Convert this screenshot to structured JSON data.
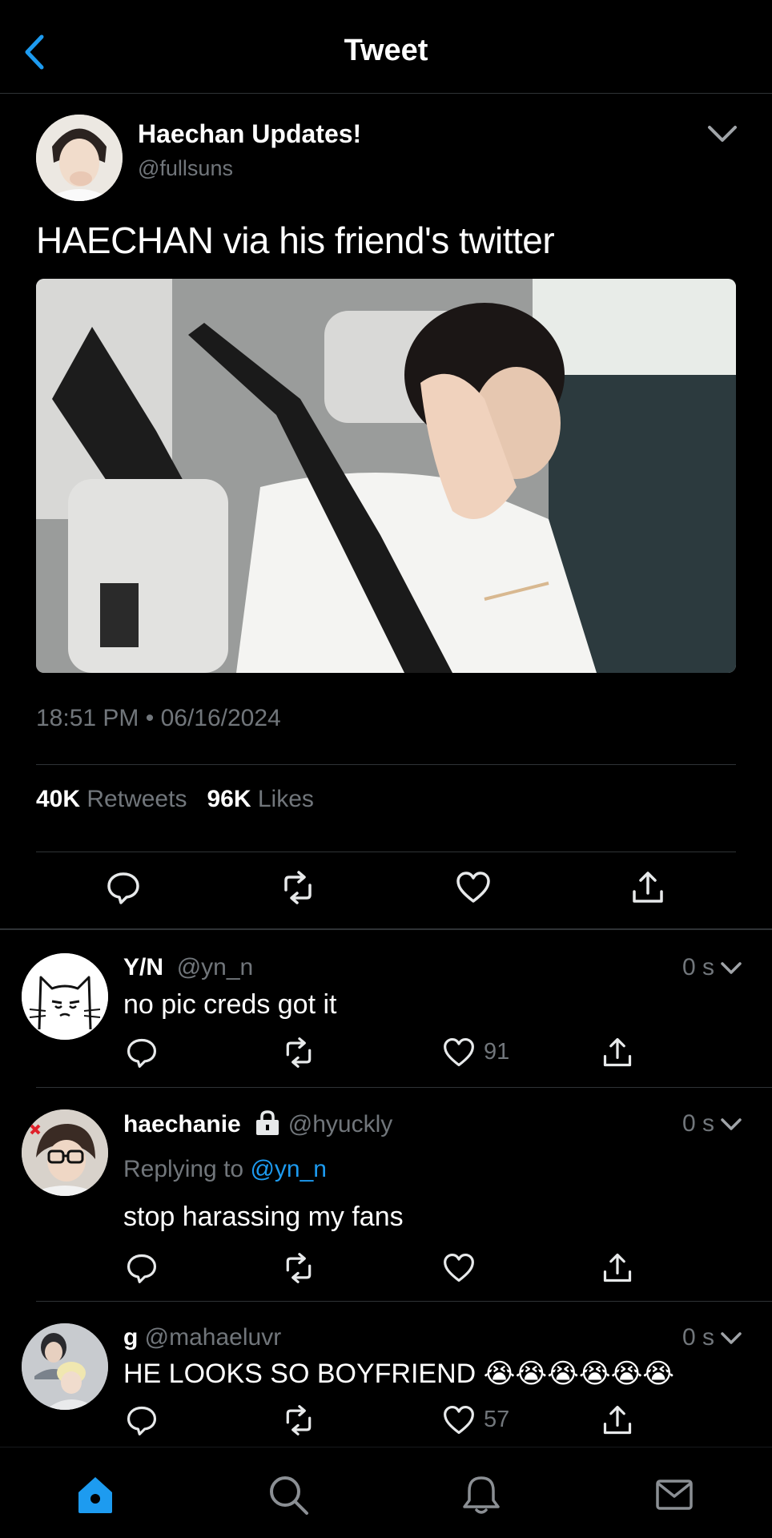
{
  "header": {
    "title": "Tweet"
  },
  "main_tweet": {
    "author_name": "Haechan Updates!",
    "author_handle": "@fullsuns",
    "text": "HAECHAN via his friend's twitter",
    "timestamp": "18:51 PM • 06/16/2024",
    "retweets_count": "40K",
    "retweets_label": "Retweets",
    "likes_count": "96K",
    "likes_label": "Likes"
  },
  "replies": [
    {
      "name": "Y/N",
      "handle": "@yn_n",
      "time": "0 s",
      "text": "no pic creds got it",
      "like_count": "91"
    },
    {
      "name": "haechanie",
      "handle": "@hyuckly",
      "time": "0 s",
      "replying_prefix": "Replying to",
      "replying_to": "@yn_n",
      "text": "stop harassing my fans"
    },
    {
      "name": "g",
      "handle": "@mahaeluvr",
      "time": "0 s",
      "text": "HE LOOKS SO BOYFRIEND 😭😭😭😭😭😭",
      "like_count": "57"
    }
  ],
  "colors": {
    "accent": "#1d9bf0",
    "muted": "#71767b",
    "background": "#000000",
    "divider": "#2f3336"
  },
  "icons": [
    "back-chevron-icon",
    "chevron-down-icon",
    "reply-icon",
    "retweet-icon",
    "like-icon",
    "share-icon",
    "lock-icon",
    "home-icon",
    "search-icon",
    "notifications-icon",
    "messages-icon"
  ]
}
